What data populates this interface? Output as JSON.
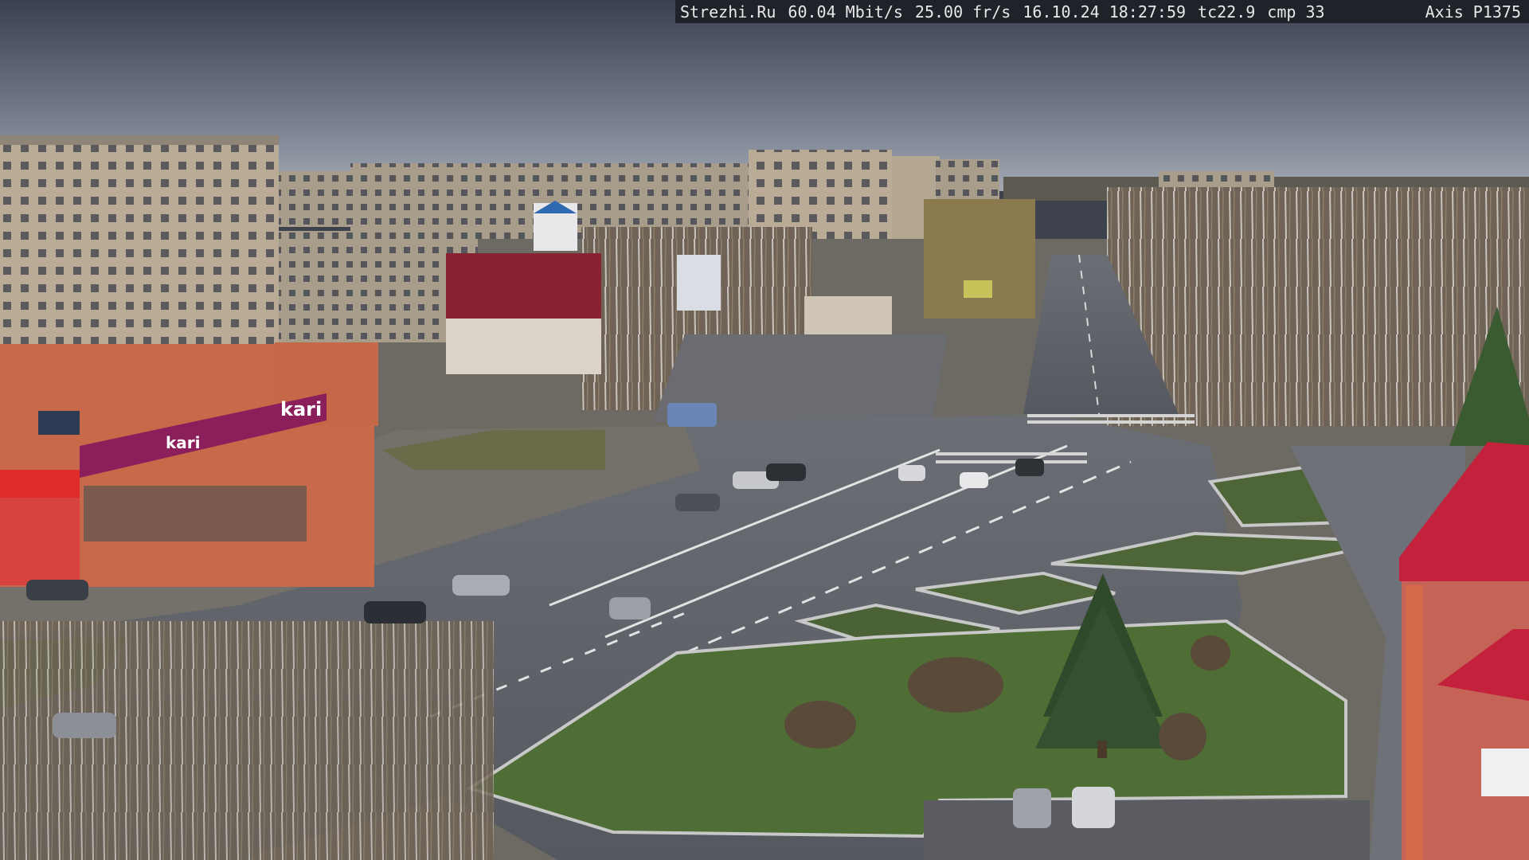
{
  "camera_overlay": {
    "site": "Strezhi.Ru",
    "bitrate": "60.04 Mbit/s",
    "framerate": "25.00 fr/s",
    "datetime": "16.10.24 18:27:59",
    "tc": "tc22.9",
    "cmp": "cmp 33",
    "camera_model": "Axis P1375"
  },
  "scene": {
    "store_signs": {
      "kari_large": "kari",
      "kari_small": "kari"
    },
    "colors": {
      "sky_top": "#3b4050",
      "sky_bottom": "#9fa6b3",
      "asphalt": "#5d6067",
      "grass": "#4a6a34",
      "store_facade": "#c86a4a",
      "kari_band": "#8a1f5c",
      "overlay_bg": "#1f2329"
    }
  }
}
